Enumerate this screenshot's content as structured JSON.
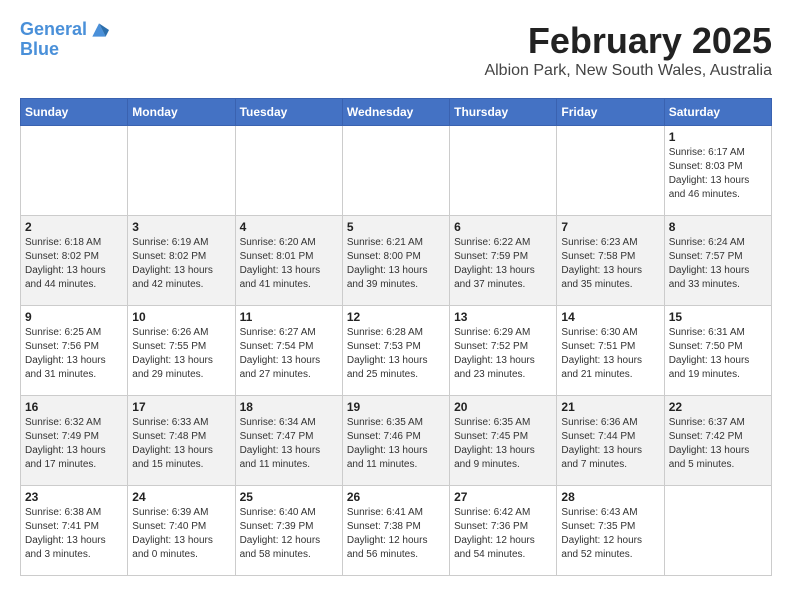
{
  "logo": {
    "line1": "General",
    "line2": "Blue"
  },
  "title": "February 2025",
  "subtitle": "Albion Park, New South Wales, Australia",
  "days_of_week": [
    "Sunday",
    "Monday",
    "Tuesday",
    "Wednesday",
    "Thursday",
    "Friday",
    "Saturday"
  ],
  "weeks": [
    [
      {
        "day": "",
        "info": ""
      },
      {
        "day": "",
        "info": ""
      },
      {
        "day": "",
        "info": ""
      },
      {
        "day": "",
        "info": ""
      },
      {
        "day": "",
        "info": ""
      },
      {
        "day": "",
        "info": ""
      },
      {
        "day": "1",
        "info": "Sunrise: 6:17 AM\nSunset: 8:03 PM\nDaylight: 13 hours\nand 46 minutes."
      }
    ],
    [
      {
        "day": "2",
        "info": "Sunrise: 6:18 AM\nSunset: 8:02 PM\nDaylight: 13 hours\nand 44 minutes."
      },
      {
        "day": "3",
        "info": "Sunrise: 6:19 AM\nSunset: 8:02 PM\nDaylight: 13 hours\nand 42 minutes."
      },
      {
        "day": "4",
        "info": "Sunrise: 6:20 AM\nSunset: 8:01 PM\nDaylight: 13 hours\nand 41 minutes."
      },
      {
        "day": "5",
        "info": "Sunrise: 6:21 AM\nSunset: 8:00 PM\nDaylight: 13 hours\nand 39 minutes."
      },
      {
        "day": "6",
        "info": "Sunrise: 6:22 AM\nSunset: 7:59 PM\nDaylight: 13 hours\nand 37 minutes."
      },
      {
        "day": "7",
        "info": "Sunrise: 6:23 AM\nSunset: 7:58 PM\nDaylight: 13 hours\nand 35 minutes."
      },
      {
        "day": "8",
        "info": "Sunrise: 6:24 AM\nSunset: 7:57 PM\nDaylight: 13 hours\nand 33 minutes."
      }
    ],
    [
      {
        "day": "9",
        "info": "Sunrise: 6:25 AM\nSunset: 7:56 PM\nDaylight: 13 hours\nand 31 minutes."
      },
      {
        "day": "10",
        "info": "Sunrise: 6:26 AM\nSunset: 7:55 PM\nDaylight: 13 hours\nand 29 minutes."
      },
      {
        "day": "11",
        "info": "Sunrise: 6:27 AM\nSunset: 7:54 PM\nDaylight: 13 hours\nand 27 minutes."
      },
      {
        "day": "12",
        "info": "Sunrise: 6:28 AM\nSunset: 7:53 PM\nDaylight: 13 hours\nand 25 minutes."
      },
      {
        "day": "13",
        "info": "Sunrise: 6:29 AM\nSunset: 7:52 PM\nDaylight: 13 hours\nand 23 minutes."
      },
      {
        "day": "14",
        "info": "Sunrise: 6:30 AM\nSunset: 7:51 PM\nDaylight: 13 hours\nand 21 minutes."
      },
      {
        "day": "15",
        "info": "Sunrise: 6:31 AM\nSunset: 7:50 PM\nDaylight: 13 hours\nand 19 minutes."
      }
    ],
    [
      {
        "day": "16",
        "info": "Sunrise: 6:32 AM\nSunset: 7:49 PM\nDaylight: 13 hours\nand 17 minutes."
      },
      {
        "day": "17",
        "info": "Sunrise: 6:33 AM\nSunset: 7:48 PM\nDaylight: 13 hours\nand 15 minutes."
      },
      {
        "day": "18",
        "info": "Sunrise: 6:34 AM\nSunset: 7:47 PM\nDaylight: 13 hours\nand 11 minutes."
      },
      {
        "day": "19",
        "info": "Sunrise: 6:35 AM\nSunset: 7:46 PM\nDaylight: 13 hours\nand 11 minutes."
      },
      {
        "day": "20",
        "info": "Sunrise: 6:35 AM\nSunset: 7:45 PM\nDaylight: 13 hours\nand 9 minutes."
      },
      {
        "day": "21",
        "info": "Sunrise: 6:36 AM\nSunset: 7:44 PM\nDaylight: 13 hours\nand 7 minutes."
      },
      {
        "day": "22",
        "info": "Sunrise: 6:37 AM\nSunset: 7:42 PM\nDaylight: 13 hours\nand 5 minutes."
      }
    ],
    [
      {
        "day": "23",
        "info": "Sunrise: 6:38 AM\nSunset: 7:41 PM\nDaylight: 13 hours\nand 3 minutes."
      },
      {
        "day": "24",
        "info": "Sunrise: 6:39 AM\nSunset: 7:40 PM\nDaylight: 13 hours\nand 0 minutes."
      },
      {
        "day": "25",
        "info": "Sunrise: 6:40 AM\nSunset: 7:39 PM\nDaylight: 12 hours\nand 58 minutes."
      },
      {
        "day": "26",
        "info": "Sunrise: 6:41 AM\nSunset: 7:38 PM\nDaylight: 12 hours\nand 56 minutes."
      },
      {
        "day": "27",
        "info": "Sunrise: 6:42 AM\nSunset: 7:36 PM\nDaylight: 12 hours\nand 54 minutes."
      },
      {
        "day": "28",
        "info": "Sunrise: 6:43 AM\nSunset: 7:35 PM\nDaylight: 12 hours\nand 52 minutes."
      },
      {
        "day": "",
        "info": ""
      }
    ]
  ]
}
